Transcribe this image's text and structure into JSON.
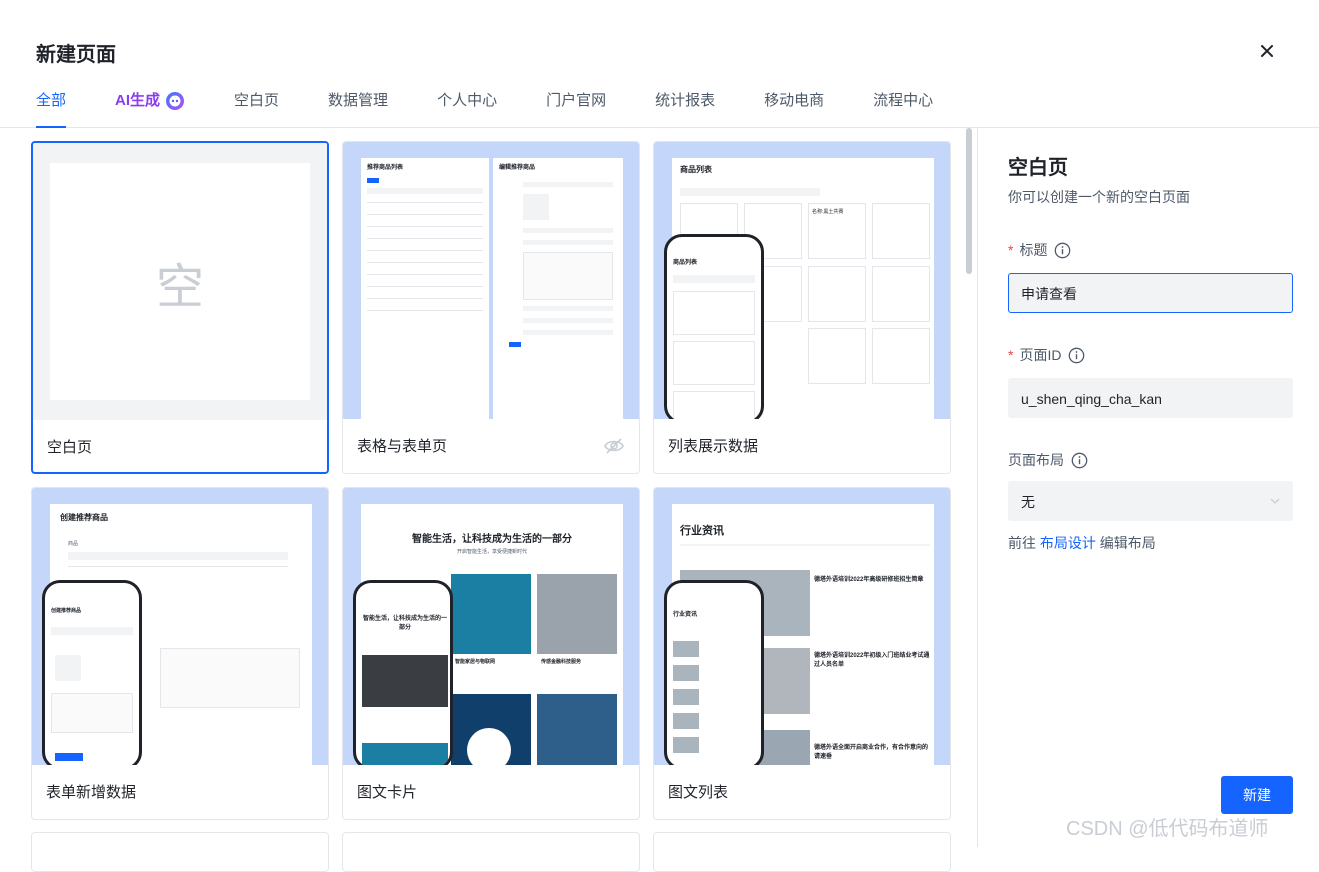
{
  "header": {
    "title": "新建页面",
    "close_icon": "close-icon"
  },
  "tabs": [
    {
      "label": "全部",
      "active": true
    },
    {
      "label": "AI生成",
      "ai": true
    },
    {
      "label": "空白页"
    },
    {
      "label": "数据管理"
    },
    {
      "label": "个人中心"
    },
    {
      "label": "门户官网"
    },
    {
      "label": "统计报表"
    },
    {
      "label": "移动电商"
    },
    {
      "label": "流程中心"
    }
  ],
  "templates": [
    {
      "label": "空白页",
      "placeholder": "空",
      "selected": true
    },
    {
      "label": "表格与表单页",
      "hidden_icon": "eye-off-icon"
    },
    {
      "label": "列表展示数据"
    },
    {
      "label": "表单新增数据"
    },
    {
      "label": "图文卡片"
    },
    {
      "label": "图文列表"
    }
  ],
  "thumbs": {
    "table_form": {
      "left_title": "推荐商品列表",
      "right_title": "编辑推荐商品"
    },
    "list": {
      "title": "商品列表",
      "card_title": "名称:黑土共赛",
      "phone_title": "商品列表"
    },
    "form_new": {
      "title": "创建推荐商品",
      "phone_title": "创建推荐商品",
      "field": "商品",
      "placeholder": "请选择"
    },
    "card": {
      "headline": "智能生活，让科技成为生活的一部分",
      "sub": "开启智能生活，享受便捷新时代",
      "item1": "智能家居与物联网",
      "item2": "传感金融科技服务",
      "phone_headline": "智能生活，让科技成为生活的一部分"
    },
    "article": {
      "title": "行业资讯",
      "item1": "德塔外语培训2022年高级研修班招生简章",
      "item2": "德塔外语培训2022年初级入门班结业考试通过人员名单",
      "item3": "德塔外语全面开启商业合作，有合作意向的请速垂",
      "phone_title": "行业资讯"
    }
  },
  "panel": {
    "title": "空白页",
    "description": "你可以创建一个新的空白页面",
    "title_label": "标题",
    "title_value": "申请查看",
    "id_label": "页面ID",
    "id_value": "u_shen_qing_cha_kan",
    "layout_label": "页面布局",
    "layout_value": "无",
    "link_prefix": "前往",
    "link_text": "布局设计",
    "link_suffix": "编辑布局",
    "create_button": "新建"
  },
  "watermark": "CSDN @低代码布道师",
  "colors": {
    "accent": "#1664ff",
    "ai": "#8a3cf0",
    "required": "#f53f3f",
    "thumb_bg": "#c5d6fb"
  }
}
